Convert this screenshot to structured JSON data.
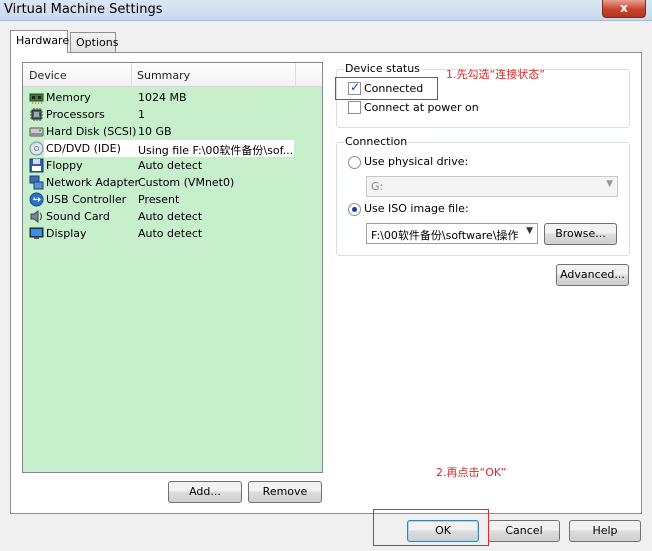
{
  "window": {
    "title": "Virtual Machine Settings",
    "close_glyph": "x"
  },
  "tabs": [
    {
      "label": "Hardware",
      "active": true
    },
    {
      "label": "Options",
      "active": false
    }
  ],
  "device_list": {
    "columns": [
      "Device",
      "Summary"
    ],
    "rows": [
      {
        "icon": "memory-icon",
        "name": "Memory",
        "summary": "1024 MB"
      },
      {
        "icon": "processor-icon",
        "name": "Processors",
        "summary": "1"
      },
      {
        "icon": "hard-disk-icon",
        "name": "Hard Disk (SCSI)",
        "summary": "10 GB"
      },
      {
        "icon": "cd-dvd-icon",
        "name": "CD/DVD (IDE)",
        "summary": "Using file F:\\00软件备份\\sof...",
        "selected": true
      },
      {
        "icon": "floppy-icon",
        "name": "Floppy",
        "summary": "Auto detect"
      },
      {
        "icon": "network-adapter-icon",
        "name": "Network Adapter",
        "summary": "Custom (VMnet0)"
      },
      {
        "icon": "usb-icon",
        "name": "USB Controller",
        "summary": "Present"
      },
      {
        "icon": "sound-card-icon",
        "name": "Sound Card",
        "summary": "Auto detect"
      },
      {
        "icon": "display-icon",
        "name": "Display",
        "summary": "Auto detect"
      }
    ],
    "add_label": "Add...",
    "remove_label": "Remove"
  },
  "device_status": {
    "title": "Device status",
    "connected_label": "Connected",
    "connected_checked": true,
    "connect_at_power_on_label": "Connect at power on",
    "connect_at_power_on_checked": false
  },
  "connection": {
    "title": "Connection",
    "physical_drive_label": "Use physical drive:",
    "physical_drive_value": "G:",
    "iso_label": "Use ISO image file:",
    "iso_value": "F:\\00软件备份\\software\\操作",
    "browse_label": "Browse...",
    "selected_option": "iso"
  },
  "advanced_label": "Advanced...",
  "footer": {
    "ok_label": "OK",
    "cancel_label": "Cancel",
    "help_label": "Help"
  },
  "annotations": {
    "step1": "1.先勾选“连接状态”",
    "step2": "2.再点击“OK”",
    "color": "#d42b2b"
  }
}
